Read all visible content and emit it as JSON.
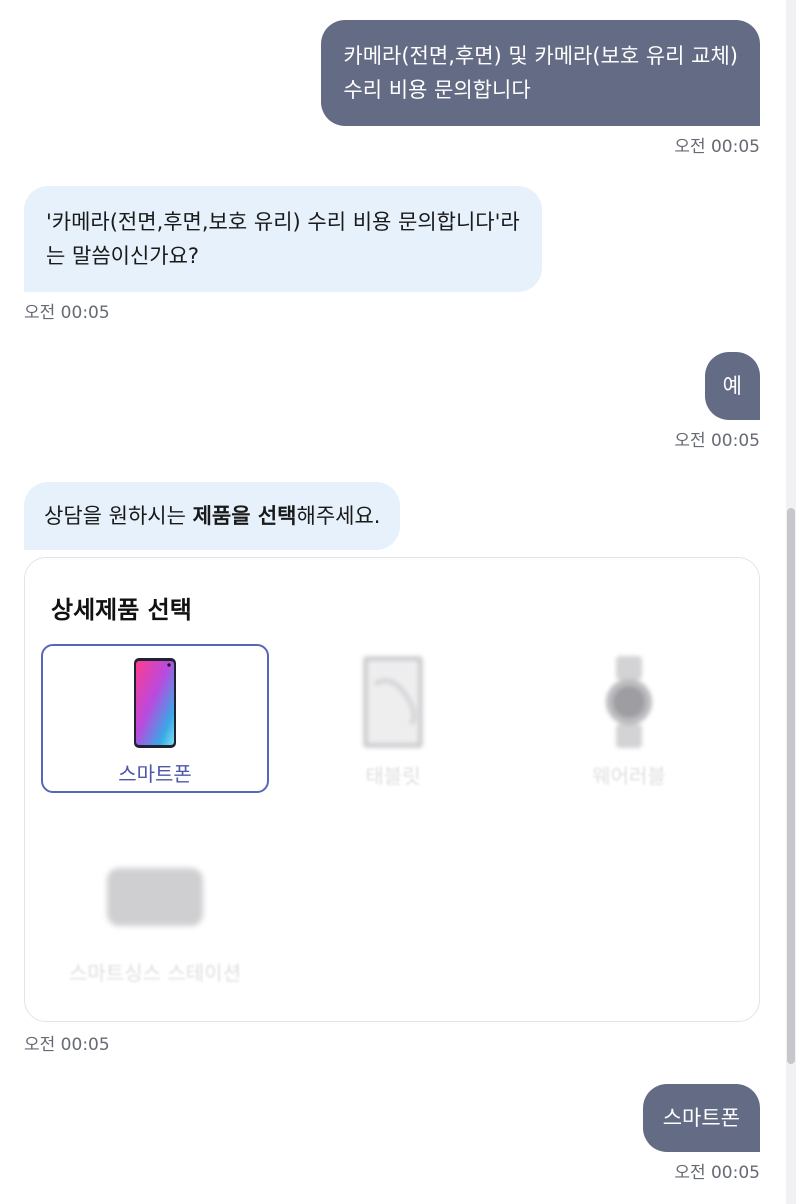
{
  "messages": {
    "m1": {
      "text_line1": "카메라(전면,후면) 및 카메라(보호 유리 교체)",
      "text_line2": "수리 비용 문의합니다",
      "time": "오전 00:05"
    },
    "m2": {
      "text_line1": "'카메라(전면,후면,보호 유리) 수리 비용 문의합니다'라",
      "text_line2": "는 말씀이신가요?",
      "time": "오전 00:05"
    },
    "m3": {
      "text": "예",
      "time": "오전 00:05"
    },
    "m4": {
      "part1": "상담을 원하시는 ",
      "bold": "제품을 선택",
      "part2": "해주세요."
    },
    "m5": {
      "text": "스마트폰",
      "time": "오전 00:05"
    }
  },
  "product_card": {
    "title": "상세제품 선택",
    "items": [
      {
        "label": "스마트폰",
        "icon": "smartphone-icon",
        "selected": true
      },
      {
        "label": "태블릿",
        "icon": "tablet-icon",
        "selected": false
      },
      {
        "label": "웨어러블",
        "icon": "smartwatch-icon",
        "selected": false
      },
      {
        "label": "스마트싱스 스테이션",
        "icon": "smartthings-station-icon",
        "selected": false
      }
    ],
    "time": "오전 00:05"
  },
  "colors": {
    "user_bubble": "#646b84",
    "bot_bubble": "#e6f1fb",
    "accent": "#5865b8"
  }
}
